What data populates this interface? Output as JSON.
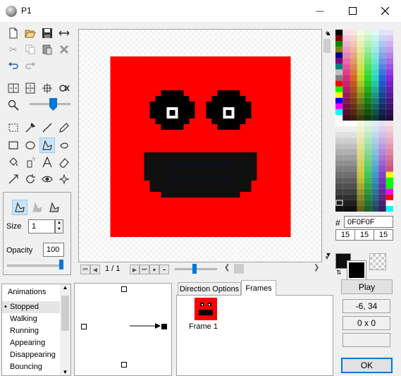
{
  "window": {
    "title": "P1",
    "minimize": "—",
    "maximize": "☐",
    "close": "✕"
  },
  "canvas": {
    "frame_counter": "1 / 1"
  },
  "brush": {
    "size_label": "Size",
    "size_value": "1",
    "opacity_label": "Opacity",
    "opacity_value": "100",
    "opacity_level_percent": 100
  },
  "color": {
    "hash": "#",
    "hex": "0F0F0F",
    "r": "15",
    "g": "15",
    "b": "15",
    "primary": "#0f0f0f",
    "secondary": "#000000"
  },
  "animations": {
    "header": "Animations",
    "items": [
      "Stopped",
      "Walking",
      "Running",
      "Appearing",
      "Disappearing",
      "Bouncing"
    ],
    "selected": "Stopped"
  },
  "tabs": {
    "direction": "Direction Options",
    "frames": "Frames"
  },
  "frames": [
    {
      "label": "Frame 1"
    }
  ],
  "buttons": {
    "play": "Play",
    "ok": "OK"
  },
  "info": {
    "coords": "-6, 34",
    "selection_size": "0 x 0",
    "extra": ""
  },
  "colors": {
    "sprite_red": "#ff0000",
    "selection_blue": "#0078d7",
    "ok_border": "#0078d7"
  }
}
